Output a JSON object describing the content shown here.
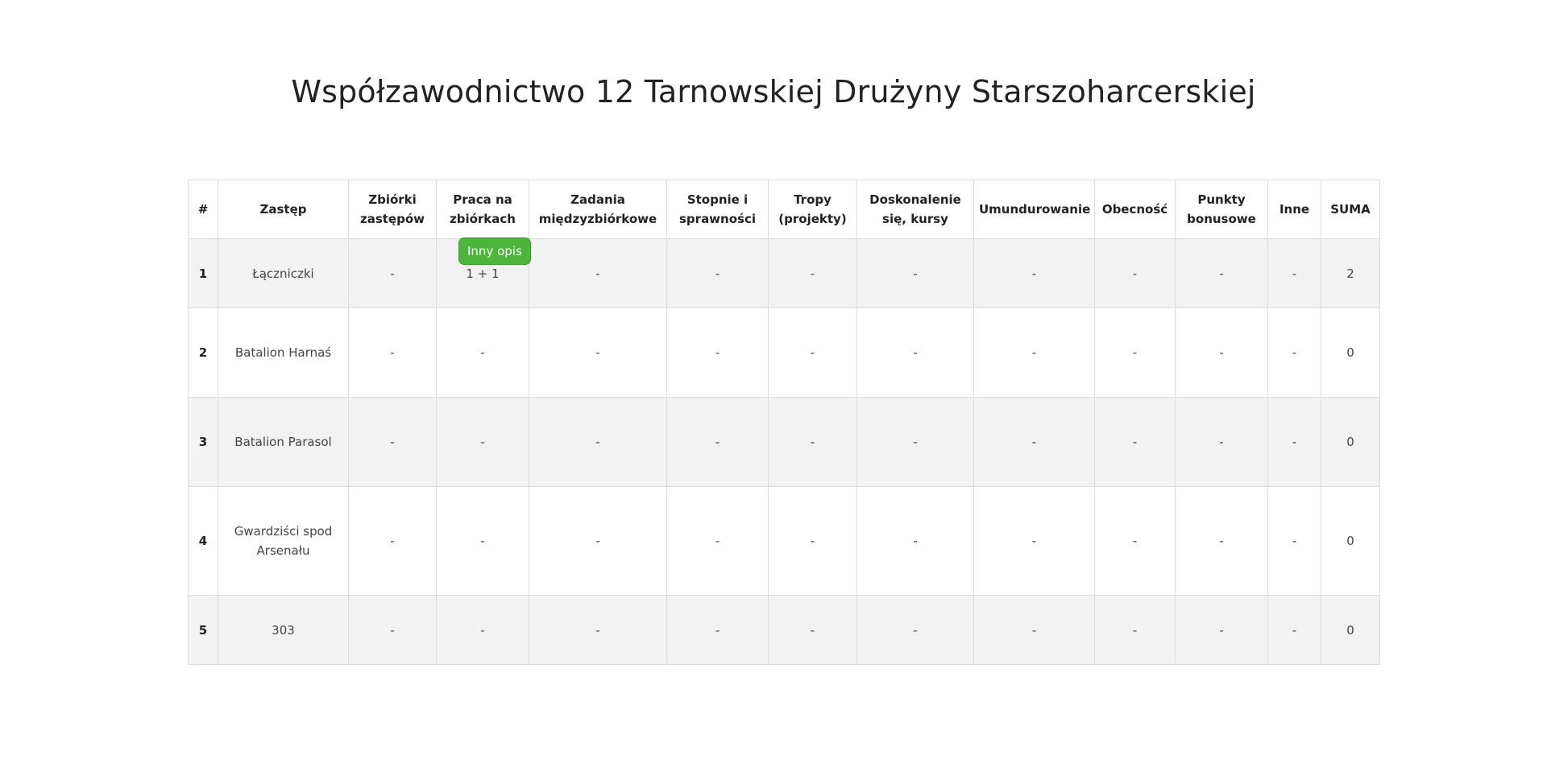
{
  "title": "Współzawodnictwo 12 Tarnowskiej Drużyny Starszoharcerskiej",
  "columns": [
    "#",
    "Zastęp",
    "Zbiórki zastępów",
    "Praca na zbiórkach",
    "Zadania międzyzbiórkowe",
    "Stopnie i sprawności",
    "Tropy (projekty)",
    "Doskonalenie się, kursy",
    "Umundurowanie",
    "Obecność",
    "Punkty bonusowe",
    "Inne",
    "SUMA"
  ],
  "rows": [
    {
      "idx": "1",
      "name": "Łączniczki",
      "c1": "-",
      "c2": "1 + 1",
      "c3": "-",
      "c4": "-",
      "c5": "-",
      "c6": "-",
      "c7": "-",
      "c8": "-",
      "c9": "-",
      "c10": "-",
      "sum": "2"
    },
    {
      "idx": "2",
      "name": "Batalion Harnaś",
      "c1": "-",
      "c2": "-",
      "c3": "-",
      "c4": "-",
      "c5": "-",
      "c6": "-",
      "c7": "-",
      "c8": "-",
      "c9": "-",
      "c10": "-",
      "sum": "0"
    },
    {
      "idx": "3",
      "name": "Batalion Parasol",
      "c1": "-",
      "c2": "-",
      "c3": "-",
      "c4": "-",
      "c5": "-",
      "c6": "-",
      "c7": "-",
      "c8": "-",
      "c9": "-",
      "c10": "-",
      "sum": "0"
    },
    {
      "idx": "4",
      "name": "Gwardziści spod Arsenału",
      "c1": "-",
      "c2": "-",
      "c3": "-",
      "c4": "-",
      "c5": "-",
      "c6": "-",
      "c7": "-",
      "c8": "-",
      "c9": "-",
      "c10": "-",
      "sum": "0"
    },
    {
      "idx": "5",
      "name": "303",
      "c1": "-",
      "c2": "-",
      "c3": "-",
      "c4": "-",
      "c5": "-",
      "c6": "-",
      "c7": "-",
      "c8": "-",
      "c9": "-",
      "c10": "-",
      "sum": "0"
    }
  ],
  "tooltip": "Inny opis",
  "colors": {
    "tooltip_bg": "#4cb63a",
    "row_stripe": "#f2f2f2",
    "border": "#dcdcdc"
  }
}
